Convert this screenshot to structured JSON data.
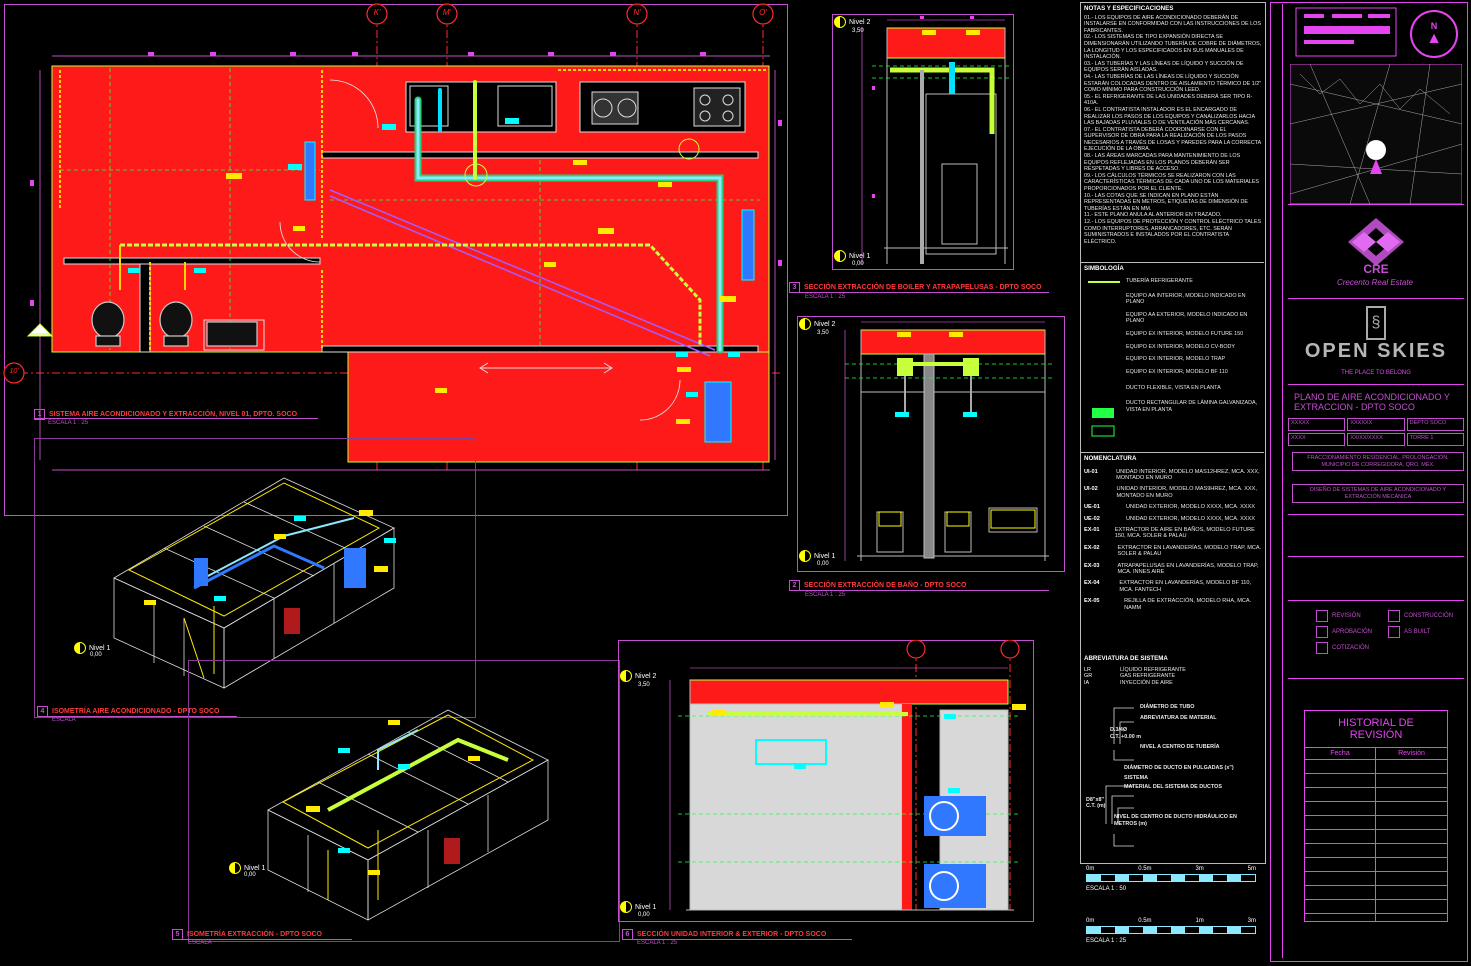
{
  "drawing": {
    "grid_labels": [
      "K'",
      "M'",
      "N'",
      "O'",
      "10'",
      "11'"
    ],
    "grid_label_side": "10'",
    "plan_title": "SISTEMA AIRE ACONDICIONADO Y EXTRACCIÓN, NIVEL 01, DPTO. SOCO",
    "plan_num": "1",
    "plan_scale": "ESCALA 1 : 25",
    "section3_title": "SECCIÓN EXTRACCIÓN DE BOILER Y ATRAPAPELUSAS - DPTO SOCO",
    "section3_num": "3",
    "section3_scale": "ESCALA 1 : 25",
    "section2_title": "SECCIÓN EXTRACCIÓN DE BAÑO - DPTO SOCO",
    "section2_num": "2",
    "section2_scale": "ESCALA 1 : 25",
    "iso1_title": "ISOMETRÍA AIRE ACONDICIONADO - DPTO SOCO",
    "iso1_num": "4",
    "iso1_scale": "ESCALA",
    "iso2_title": "ISOMETRÍA EXTRACCIÓN - DPTO SOCO",
    "iso2_num": "5",
    "iso2_scale": "ESCALA",
    "section6_title": "SECCIÓN UNIDAD INTERIOR & EXTERIOR - DPTO SOCO",
    "section6_num": "6",
    "section6_scale": "ESCALA 1 : 25",
    "level2": "Nivel 2",
    "level2_val": "3,50",
    "level1": "Nivel 1",
    "level1_val": "0,00"
  },
  "notes": {
    "heading": "NOTAS Y ESPECIFICACIONES",
    "lines": [
      "01.- LOS EQUIPOS DE AIRE ACONDICIONADO DEBERÁN DE INSTALARSE EN CONFORMIDAD CON LAS INSTRUCCIONES DE LOS FABRICANTES.",
      "02.- LOS SISTEMAS DE TIPO EXPANSIÓN DIRECTA SE DIMENSIONARÁN UTILIZANDO TUBERÍA DE COBRE DE DIÁMETROS, LA LONGITUD Y LOS ESPECIFICADOS EN SUS MANUALES DE INSTALACIÓN.",
      "03.- LAS TUBERÍAS Y LAS LÍNEAS DE LÍQUIDO Y SUCCIÓN DE EQUIPOS SERÁN AISLADAS.",
      "04.- LAS TUBERÍAS DE LAS LÍNEAS DE LÍQUIDO Y SUCCIÓN ESTARÁN COLOCADAS DENTRO DE AISLAMIENTO TÉRMICO DE 1/2\" COMO MÍNIMO PARA CONSTRUCCIÓN LEED.",
      "05.- EL REFRIGERANTE DE LAS UNIDADES DEBERÁ SER TIPO R-410A.",
      "06.- EL CONTRATISTA INSTALADOR ES EL ENCARGADO DE REALIZAR LOS PASOS DE LOS EQUIPOS Y CANALIZARLOS HACIA LAS BAJADAS PLUVIALES O DE VENTILACIÓN MÁS CERCANAS.",
      "07.- EL CONTRATISTA DEBERÁ COORDINARSE CON EL SUPERVISOR DE OBRA PARA LA REALIZACIÓN DE LOS PASOS NECESARIOS A TRAVÉS DE LOSAS Y PAREDES PARA LA CORRECTA EJECUCIÓN DE LA OBRA.",
      "08.- LAS ÁREAS MARCADAS PARA MANTENIMIENTO DE LOS EQUIPOS REFLEJADAS EN LOS PLANOS DEBERÁN SER RESPETADAS Y LIBRES DE ACCESO.",
      "09.- LOS CÁLCULOS TÉRMICOS SE REALIZARON CON LAS CARACTERÍSTICAS TÉRMICAS DE CADA UNO DE LOS MATERIALES PROPORCIONADOS POR EL CLIENTE.",
      "10.- LAS COTAS QUE SE INDICAN EN PLANO ESTÁN REPRESENTADAS EN METROS, ETIQUETAS DE DIMENSIÓN DE TUBERÍAS ESTÁN EN MM.",
      "11.- ESTE PLANO ANULA AL ANTERIOR EN TRAZADO.",
      "12.- LOS EQUIPOS DE PROTECCIÓN Y CONTROL ELÉCTRICO TALES COMO INTERRUPTORES, ARRANCADORES, ETC. SERÁN SUMINISTRADOS E INSTALADOS POR EL CONTRATISTA ELÉCTRICO."
    ]
  },
  "symbology": {
    "heading": "SIMBOLOGÍA",
    "items": [
      "TUBERÍA REFRIGERANTE",
      "EQUIPO AA INTERIOR, MODELO INDICADO EN PLANO",
      "EQUIPO AA EXTERIOR, MODELO INDICADO EN PLANO",
      "EQUIPO EX INTERIOR, MODELO FUTURE 150",
      "EQUIPO EX INTERIOR, MODELO CV-BODY",
      "EQUIPO EX INTERIOR, MODELO TRAP",
      "EQUIPO EX INTERIOR, MODELO BF 110",
      "DUCTO FLEXIBLE, VISTA EN PLANTA",
      "DUCTO RECTANGULAR DE LÁMINA GALVANIZADA, VISTA EN PLANTA"
    ]
  },
  "nomenclature": {
    "heading": "NOMENCLATURA",
    "items": [
      {
        "code": "UI-01",
        "desc": "UNIDAD INTERIOR, MODELO MAS12HREZ, MCA. XXX, MONTADO EN MURO"
      },
      {
        "code": "UI-02",
        "desc": "UNIDAD INTERIOR, MODELO MAS9HREZ, MCA. XXX, MONTADO EN MURO"
      },
      {
        "code": "UE-01",
        "desc": "UNIDAD EXTERIOR, MODELO XXXX, MCA. XXXX"
      },
      {
        "code": "UE-02",
        "desc": "UNIDAD EXTERIOR, MODELO XXXX, MCA. XXXX"
      },
      {
        "code": "EX-01",
        "desc": "EXTRACTOR DE AIRE EN BAÑOS, MODELO FUTURE 150, MCA. SOLER & PALAU"
      },
      {
        "code": "EX-02",
        "desc": "EXTRACTOR EN LAVANDERÍAS, MODELO TRAP, MCA. SOLER & PALAU"
      },
      {
        "code": "EX-03",
        "desc": "ATRAPAPELUSAS EN LAVANDERÍAS, MODELO TRAP, MCA. INNES AIRE"
      },
      {
        "code": "EX-04",
        "desc": "EXTRACTOR EN LAVANDERÍAS, MODELO BF 110, MCA. FANTECH"
      },
      {
        "code": "EX-05",
        "desc": "REJILLA DE EXTRACCIÓN, MODELO RHA, MCA. NAMM"
      }
    ]
  },
  "abbreviations": {
    "heading": "ABREVIATURA DE SISTEMA",
    "codes": [
      "LR",
      "GR",
      "IA"
    ],
    "descs": [
      "LÍQUIDO REFRIGERANTE",
      "GAS REFRIGERANTE",
      "INYECCIÓN DE AIRE"
    ],
    "diag1": [
      "DIÁMETRO DE TUBO",
      "ABREVIATURA DE MATERIAL",
      "D.3/4Ø",
      "C.T. +0.00 m",
      "NIVEL A CENTRO DE TUBERÍA"
    ],
    "diag2": [
      "DIÁMETRO DE DUCTO EN PULGADAS (x\")",
      "SISTEMA",
      "MATERIAL DEL SISTEMA DE DUCTOS",
      "D8\"x8\"",
      "C.T. (m)",
      "NIVEL DE CENTRO DE DUCTO HIDRÁULICO EN METROS (m)"
    ]
  },
  "scales": {
    "bar1_labels": [
      "0m",
      "0.5m",
      "3m",
      "5m"
    ],
    "bar1_caption": "ESCALA 1 : 50",
    "bar2_labels": [
      "0m",
      "0.5m",
      "1m",
      "3m"
    ],
    "bar2_caption": "ESCALA 1 : 25"
  },
  "titleblock": {
    "north_label": "N",
    "brand1_abbr": "CRE",
    "brand1_name": "Crecento Real Estate",
    "brand2_name": "OPEN SKIES",
    "brand2_tagline": "THE PLACE TO BELONG",
    "drawing_title": "PLANO DE AIRE ACONDICIONADO Y EXTRACCION - DPTO SOCO",
    "fields": [
      "XXXXX",
      "XXXXXX",
      "DEPTO SOCO",
      "XXXX",
      "XX/XX/XXXX",
      "TORRE 1"
    ],
    "project_info": "FRACCIONAMIENTO RESIDENCIAL, PROLONGACIÓN, MUNICIPIO DE CORREGIDORA, QRO, MÉX.",
    "designer_info": "DISEÑO DE SISTEMAS DE AIRE ACONDICIONADO Y EXTRACCIÓN MECÁNICA",
    "checkboxes": [
      "REVISIÓN",
      "APROBACIÓN",
      "COTIZACIÓN",
      "CONSTRUCCIÓN",
      "AS BUILT"
    ],
    "history_title": "HISTORIAL DE REVISIÓN",
    "history_cols": [
      "Fecha",
      "Revisión"
    ]
  },
  "colors": {
    "magenta": "#e445f0",
    "room_red": "#ff1a1a",
    "yellow": "#ffea00",
    "cyan": "#00ffff",
    "green": "#22ff44",
    "blue": "#2f78ff",
    "violet": "#a45bff"
  }
}
